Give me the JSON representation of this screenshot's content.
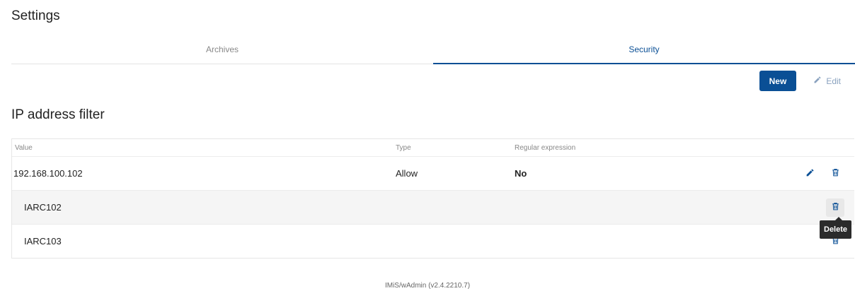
{
  "page": {
    "title": "Settings"
  },
  "tabs": [
    {
      "label": "Archives",
      "active": false
    },
    {
      "label": "Security",
      "active": true
    }
  ],
  "toolbar": {
    "new_label": "New",
    "edit_label": "Edit"
  },
  "section": {
    "title": "IP address filter"
  },
  "table": {
    "headers": {
      "value": "Value",
      "type": "Type",
      "regex": "Regular expression"
    },
    "rows": [
      {
        "value": "192.168.100.102",
        "type": "Allow",
        "regex": "No"
      },
      {
        "value": "IARC102",
        "type": "",
        "regex": ""
      },
      {
        "value": "IARC103",
        "type": "",
        "regex": ""
      }
    ]
  },
  "tooltip": {
    "text": "Delete"
  },
  "footer": {
    "version": "IMiS/wAdmin (v2.4.2210.7)"
  },
  "colors": {
    "accent": "#0a4f95",
    "edit_disabled": "#8aa2bf"
  }
}
